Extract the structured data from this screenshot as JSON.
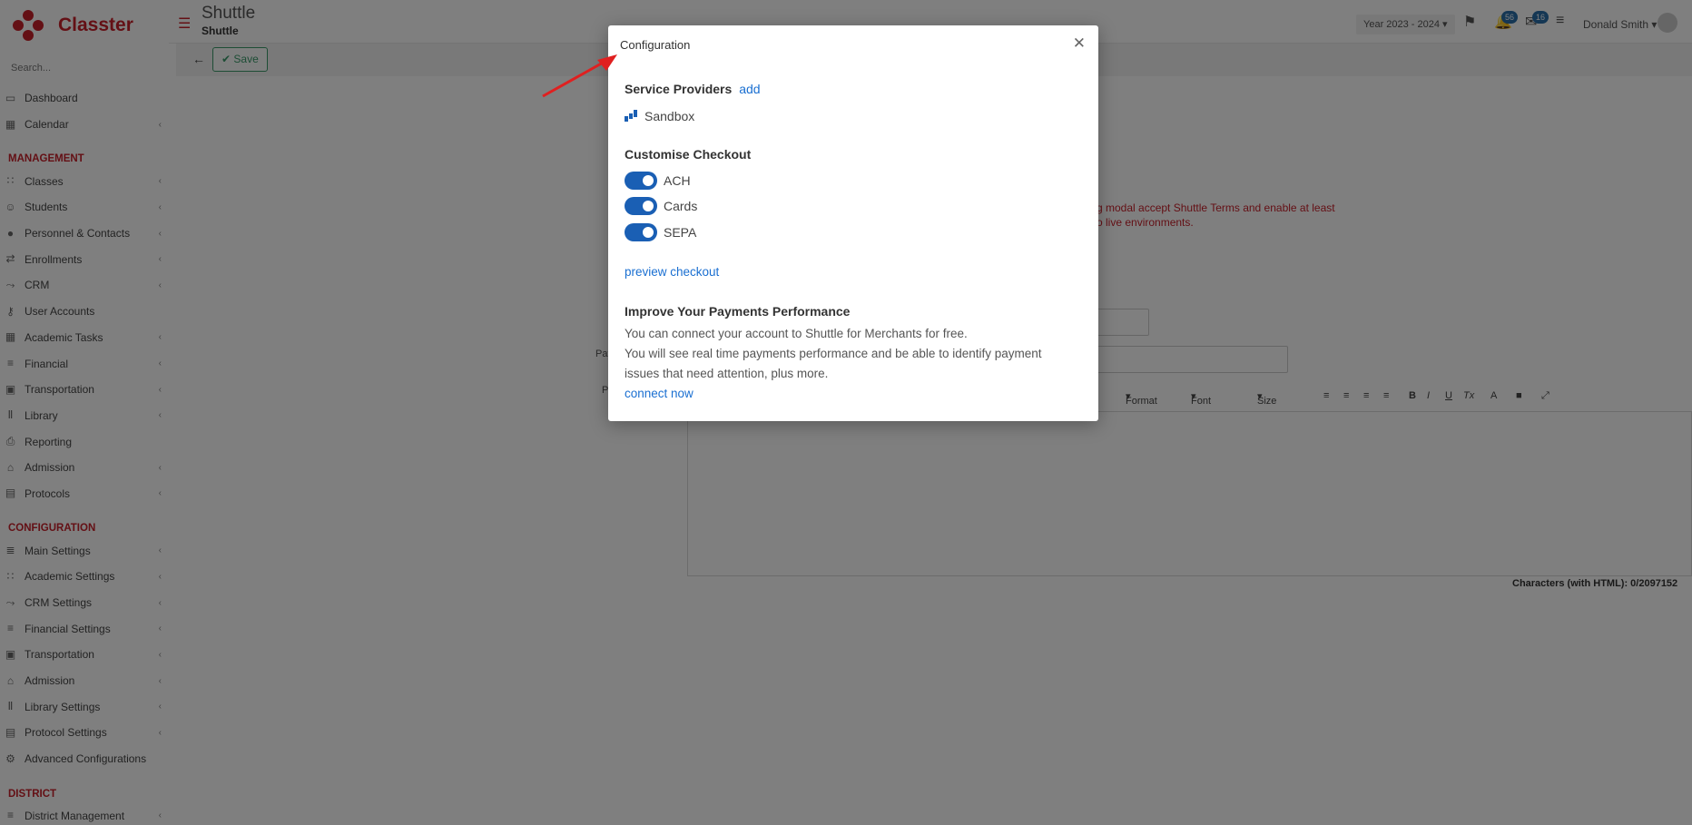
{
  "brand": {
    "name": "Classter"
  },
  "sidebar": {
    "search_placeholder": "Search...",
    "items_top": [
      {
        "label": "Dashboard",
        "icon": "monitor-icon",
        "chev": false
      },
      {
        "label": "Calendar",
        "icon": "calendar-icon",
        "chev": true
      }
    ],
    "management_title": "MANAGEMENT",
    "management": [
      {
        "label": "Classes",
        "icon": "classes-icon",
        "chev": true
      },
      {
        "label": "Students",
        "icon": "students-icon",
        "chev": true
      },
      {
        "label": "Personnel & Contacts",
        "icon": "person-icon",
        "chev": true
      },
      {
        "label": "Enrollments",
        "icon": "enroll-icon",
        "chev": true
      },
      {
        "label": "CRM",
        "icon": "crm-icon",
        "chev": true
      },
      {
        "label": "User Accounts",
        "icon": "key-icon",
        "chev": false
      },
      {
        "label": "Academic Tasks",
        "icon": "grid-icon",
        "chev": true
      },
      {
        "label": "Financial",
        "icon": "coins-icon",
        "chev": true
      },
      {
        "label": "Transportation",
        "icon": "bus-icon",
        "chev": true
      },
      {
        "label": "Library",
        "icon": "books-icon",
        "chev": true
      },
      {
        "label": "Reporting",
        "icon": "printer-icon",
        "chev": false
      },
      {
        "label": "Admission",
        "icon": "bank-icon",
        "chev": true
      },
      {
        "label": "Protocols",
        "icon": "protocol-icon",
        "chev": true
      }
    ],
    "configuration_title": "CONFIGURATION",
    "configuration": [
      {
        "label": "Main Settings",
        "icon": "sliders-icon",
        "chev": true
      },
      {
        "label": "Academic Settings",
        "icon": "classes-icon",
        "chev": true
      },
      {
        "label": "CRM Settings",
        "icon": "crm-icon",
        "chev": true
      },
      {
        "label": "Financial Settings",
        "icon": "coins-icon",
        "chev": true
      },
      {
        "label": "Transportation",
        "icon": "bus-icon",
        "chev": true
      },
      {
        "label": "Admission",
        "icon": "bank-icon",
        "chev": true
      },
      {
        "label": "Library Settings",
        "icon": "books-icon",
        "chev": true
      },
      {
        "label": "Protocol Settings",
        "icon": "protocol-icon",
        "chev": true
      },
      {
        "label": "Advanced Configurations",
        "icon": "gears-icon",
        "chev": false
      }
    ],
    "district_title": "DISTRICT",
    "district": [
      {
        "label": "District Management",
        "icon": "list-icon",
        "chev": true
      }
    ]
  },
  "header": {
    "title": "Shuttle",
    "subtitle": "Shuttle",
    "year": "Year 2023 - 2024",
    "notifications_count": "56",
    "messages_count": "16",
    "user_name": "Donald Smith"
  },
  "toolbar": {
    "save_label": "Save"
  },
  "background": {
    "warning_line1": "g modal accept Shuttle Terms and enable at least",
    "warning_line2": "o live environments.",
    "label_pay": "Pay",
    "label_p": "P",
    "editor_format": "Format",
    "editor_font": "Font",
    "editor_size": "Size",
    "char_count": "Characters (with HTML): 0/2097152"
  },
  "modal": {
    "title": "Configuration",
    "service_providers_heading": "Service Providers",
    "add_link": "add",
    "provider_name": "Sandbox",
    "customise_heading": "Customise Checkout",
    "toggles": [
      {
        "label": "ACH",
        "on": true
      },
      {
        "label": "Cards",
        "on": true
      },
      {
        "label": "SEPA",
        "on": true
      }
    ],
    "preview_link": "preview checkout",
    "improve_heading": "Improve Your Payments Performance",
    "improve_text1": "You can connect your account to Shuttle for Merchants for free.",
    "improve_text2": "You will see real time payments performance and be able to identify payment issues that need attention, plus more.",
    "connect_link": "connect now"
  },
  "colors": {
    "brand": "#c8202b",
    "accent": "#1a5fb4",
    "link": "#1a6fd1"
  }
}
